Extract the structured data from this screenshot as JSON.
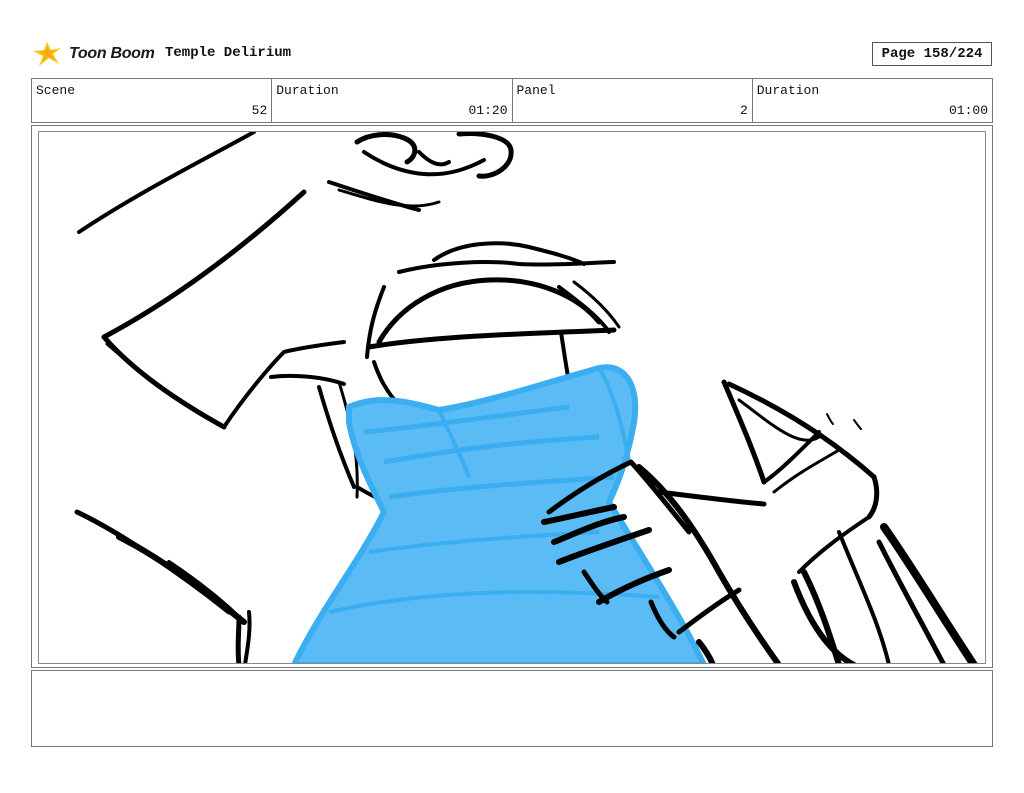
{
  "header": {
    "logo_text": "Toon Boom",
    "project_title": "Temple Delirium",
    "page_label": "Page 158/224"
  },
  "info": {
    "scene_label": "Scene",
    "scene_value": "52",
    "scene_duration_label": "Duration",
    "scene_duration_value": "01:20",
    "panel_label": "Panel",
    "panel_value": "2",
    "panel_duration_label": "Duration",
    "panel_duration_value": "01:00"
  },
  "notes": {
    "text": ""
  },
  "colors": {
    "sketch_fill": "#5bbcf5",
    "sketch_stroke": "#3aaef0",
    "ink": "#000000",
    "logo_accent": "#f5c518"
  },
  "icons": {
    "logo": "toon-boom-star-icon"
  }
}
